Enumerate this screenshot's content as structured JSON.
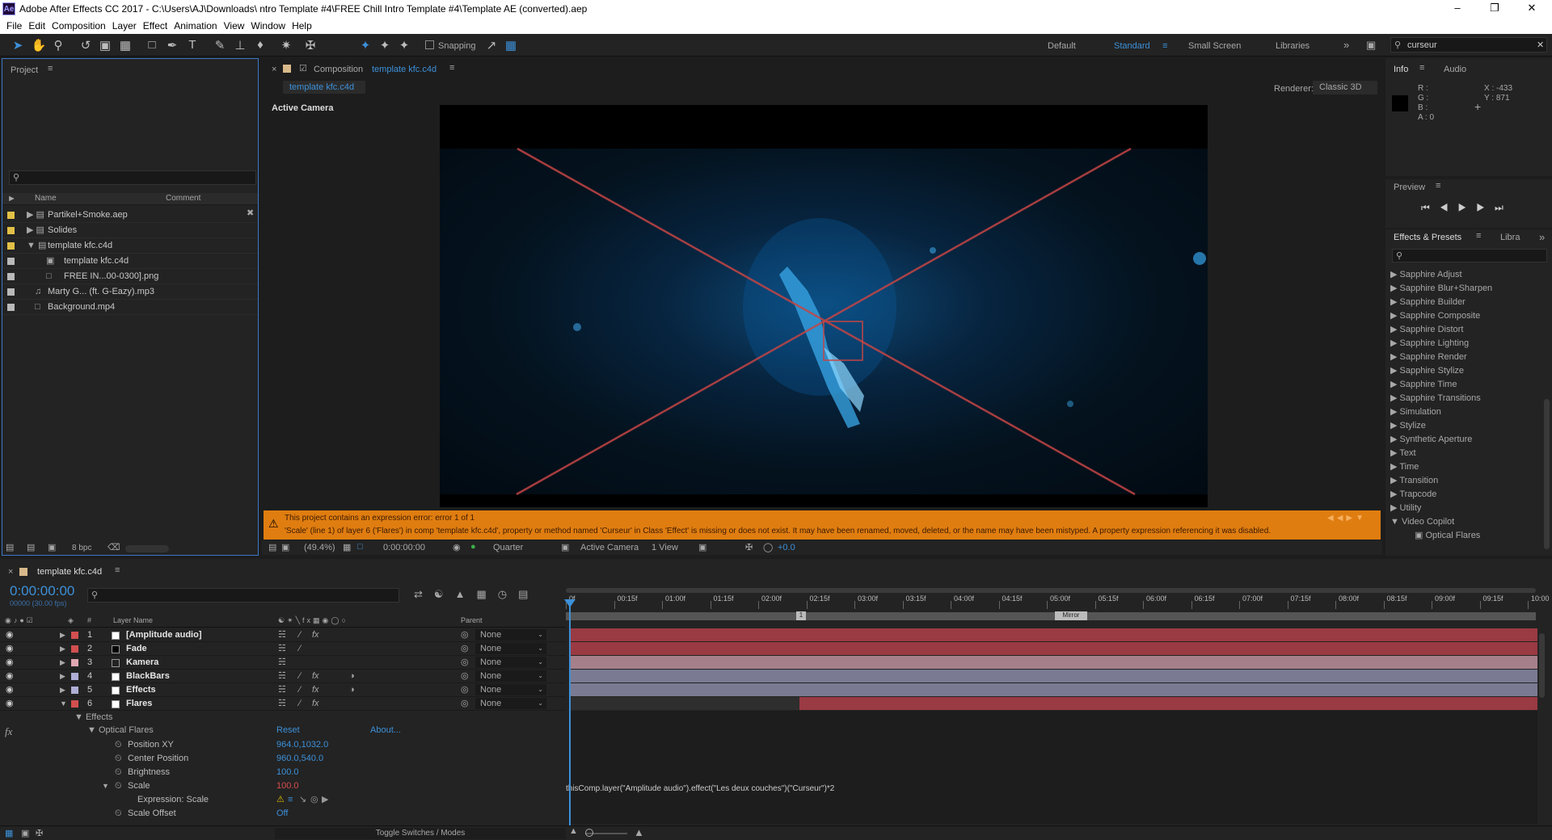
{
  "window": {
    "title": "Adobe After Effects CC 2017 - C:\\Users\\AJ\\Downloads\\ ntro Template #4\\FREE Chill Intro Template #4\\Template AE (converted).aep",
    "app_icon": "Ae"
  },
  "menu": [
    "File",
    "Edit",
    "Composition",
    "Layer",
    "Effect",
    "Animation",
    "View",
    "Window",
    "Help"
  ],
  "toolbar": {
    "snapping_label": "Snapping",
    "workspaces": [
      "Default",
      "Standard",
      "Small Screen",
      "Libraries"
    ],
    "active_workspace": "Standard",
    "search_value": "curseur"
  },
  "project": {
    "title": "Project",
    "col_name": "Name",
    "col_comment": "Comment",
    "bpc": "8 bpc",
    "items": [
      {
        "name": "Partikel+Smoke.aep",
        "color": "#e2c047",
        "type": "folder",
        "indent": 0
      },
      {
        "name": "Solides",
        "color": "#e2c047",
        "type": "folder",
        "indent": 0
      },
      {
        "name": "template kfc.c4d",
        "color": "#e2c047",
        "type": "folder",
        "indent": 0
      },
      {
        "name": "template kfc.c4d",
        "color": "#b9b9b9",
        "type": "comp",
        "indent": 1
      },
      {
        "name": "FREE IN...00-0300].png",
        "color": "#b9b9b9",
        "type": "image",
        "indent": 1
      },
      {
        "name": "Marty G... (ft. G-Eazy).mp3",
        "color": "#b9b9b9",
        "type": "audio",
        "indent": 0
      },
      {
        "name": "Background.mp4",
        "color": "#b9b9b9",
        "type": "video",
        "indent": 0
      }
    ]
  },
  "composition": {
    "panel_prefix": "Composition",
    "name": "template kfc.c4d",
    "tab": "template kfc.c4d",
    "renderer_label": "Renderer:",
    "renderer_value": "Classic 3D",
    "view_label": "Active Camera",
    "error_line1": "This project contains an expression error: error 1 of 1",
    "error_line2": "'Scale' (line 1) of layer 6 ('Flares') in comp 'template kfc.c4d', property or method named 'Curseur' in Class 'Effect' is missing or does not exist. It may have been renamed, moved, deleted, or the name may have been mistyped. A property expression referencing it was disabled.",
    "zoom": "(49.4%)",
    "timecode": "0:00:00:00",
    "resolution": "Quarter",
    "camera": "Active Camera",
    "views": "1 View",
    "exposure": "+0.0"
  },
  "info": {
    "tab": "Info",
    "tab2": "Audio",
    "r": "R :",
    "g": "G :",
    "b": "B :",
    "a": "A : 0",
    "x": "X : -433",
    "y": "Y : 871"
  },
  "preview": {
    "title": "Preview"
  },
  "effects_presets": {
    "title": "Effects & Presets",
    "tab2": "Libra",
    "items": [
      "Sapphire Adjust",
      "Sapphire Blur+Sharpen",
      "Sapphire Builder",
      "Sapphire Composite",
      "Sapphire Distort",
      "Sapphire Lighting",
      "Sapphire Render",
      "Sapphire Stylize",
      "Sapphire Time",
      "Sapphire Transitions",
      "Simulation",
      "Stylize",
      "Synthetic Aperture",
      "Text",
      "Time",
      "Transition",
      "Trapcode",
      "Utility",
      "Video Copilot"
    ],
    "sub_item": "Optical Flares"
  },
  "timeline": {
    "tab": "template kfc.c4d",
    "timecode": "0:00:00:00",
    "fps": "00000 (30.00 fps)",
    "col_layer": "Layer Name",
    "col_parent": "Parent",
    "col_num": "#",
    "ruler": [
      "0f",
      "00:15f",
      "01:00f",
      "01:15f",
      "02:00f",
      "02:15f",
      "03:00f",
      "03:15f",
      "04:00f",
      "04:15f",
      "05:00f",
      "05:15f",
      "06:00f",
      "06:15f",
      "07:00f",
      "07:15f",
      "08:00f",
      "08:15f",
      "09:00f",
      "09:15f",
      "10:00"
    ],
    "marker1": "1",
    "marker2": "Mirror",
    "layers": [
      {
        "num": "1",
        "name": "[Amplitude audio]",
        "color": "#d14f4f",
        "parent": "None",
        "bar": "#9a3a43",
        "start": 0
      },
      {
        "num": "2",
        "name": "Fade",
        "color": "#d14f4f",
        "parent": "None",
        "bar": "#9a3a43",
        "start": 0
      },
      {
        "num": "3",
        "name": "Kamera",
        "color": "#e0a6b2",
        "parent": "None",
        "bar": "#a5808a",
        "start": 0
      },
      {
        "num": "4",
        "name": "BlackBars",
        "color": "#aeaed6",
        "parent": "None",
        "bar": "#7a7a92",
        "start": 0
      },
      {
        "num": "5",
        "name": "Effects",
        "color": "#aeaed6",
        "parent": "None",
        "bar": "#7a7a92",
        "start": 0
      },
      {
        "num": "6",
        "name": "Flares",
        "color": "#d14f4f",
        "parent": "None",
        "bar": "#9a3a43",
        "start": 0.237
      }
    ],
    "effects_label": "Effects",
    "optical_flares": "Optical Flares",
    "reset": "Reset",
    "about": "About...",
    "props": [
      {
        "name": "Position XY",
        "value": "964.0,1032.0",
        "cls": "blue"
      },
      {
        "name": "Center Position",
        "value": "960.0,540.0",
        "cls": "blue"
      },
      {
        "name": "Brightness",
        "value": "100.0",
        "cls": "blue"
      },
      {
        "name": "Scale",
        "value": "100.0",
        "cls": "red"
      },
      {
        "name": "Expression: Scale",
        "value": "",
        "cls": ""
      },
      {
        "name": "Scale Offset",
        "value": "Off",
        "cls": "blue"
      }
    ],
    "expression": "thisComp.layer(\"Amplitude audio\").effect(\"Les deux couches\")(\"Curseur\")*2",
    "toggle": "Toggle Switches / Modes"
  }
}
